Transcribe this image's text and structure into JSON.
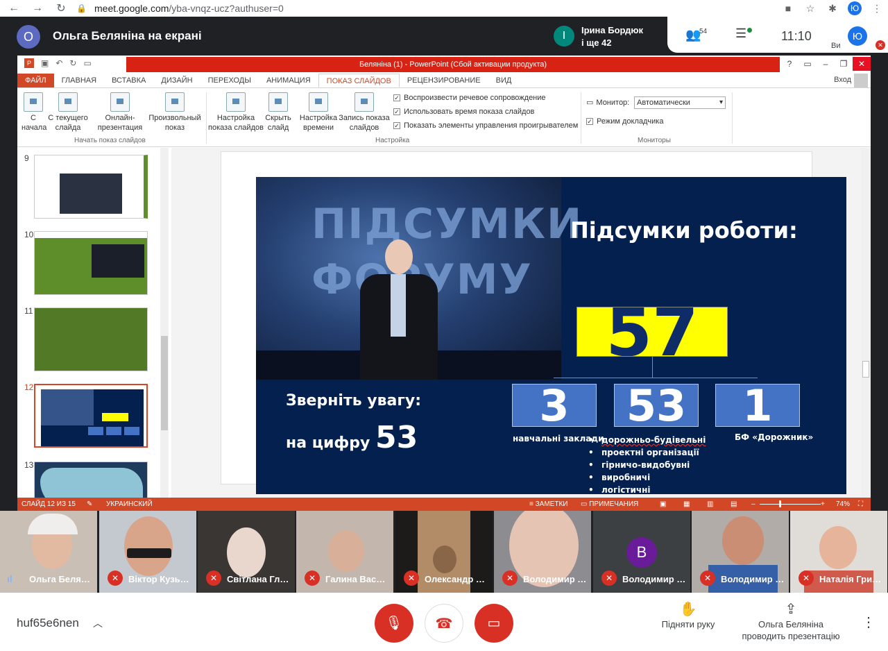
{
  "browser": {
    "url_host": "meet.google.com",
    "url_path": "/yba-vnqz-ucz?authuser=0",
    "avatar_letter": "Ю"
  },
  "meet": {
    "presenter_initial": "О",
    "presenter_title": "Ольга Беляніна на екрані",
    "speaker_initial": "І",
    "speaker_name": "Ірина Бордюк",
    "speaker_more": "і ще 42",
    "people_count": "54",
    "clock": "11:10",
    "self_initial": "Ю",
    "self_label": "Ви"
  },
  "powerpoint": {
    "window_title": "Беляніна (1) -  PowerPoint (Сбой активации продукта)",
    "tabs": [
      "ФАЙЛ",
      "ГЛАВНАЯ",
      "ВСТАВКА",
      "ДИЗАЙН",
      "ПЕРЕХОДЫ",
      "АНИМАЦИЯ",
      "ПОКАЗ СЛАЙДОВ",
      "РЕЦЕНЗИРОВАНИЕ",
      "ВИД"
    ],
    "login": "Вход",
    "ribbon": {
      "from_start": "С начала",
      "from_current": "С текущего слайда",
      "online": "Онлайн-презентация",
      "custom": "Произвольный показ",
      "group_start": "Начать показ слайдов",
      "setup": "Настройка показа слайдов",
      "hide": "Скрыть слайд",
      "timing": "Настройка времени",
      "record": "Запись показа слайдов",
      "group_setup": "Настройка",
      "chk1": "Воспроизвести речевое сопровождение",
      "chk2": "Использовать время показа слайдов",
      "chk3": "Показать элементы управления проигрывателем",
      "monitor_label": "Монитор:",
      "monitor_value": "Автоматически",
      "presenter_mode": "Режим докладчика",
      "group_monitors": "Мониторы"
    },
    "thumb_numbers": [
      "9",
      "10",
      "11",
      "12",
      "13"
    ],
    "status": {
      "slide": "СЛАЙД 12 ИЗ 15",
      "language": "УКРАИНСКИЙ",
      "notes": "ЗАМЕТКИ",
      "comments": "ПРИМЕЧАНИЯ",
      "zoom": "74%"
    }
  },
  "slide": {
    "photo_text": "ПІДСУМКИ ФОРУМУ",
    "title": "Підсумки роботи:",
    "total": "57",
    "box1": "3",
    "box2": "53",
    "box3": "1",
    "cap1": "навчальні заклади",
    "cap3": "БФ «Дорожник»",
    "bullets": [
      "дорожньо-будівельні",
      "проектні організації",
      "гірничо-видобувні",
      "виробничі",
      "логістичні"
    ],
    "attention_line1": "Зверніть увагу:",
    "attention_line2": "на цифру",
    "attention_num": "53"
  },
  "participants": [
    {
      "name": "Ольга Белян…",
      "speaking": true
    },
    {
      "name": "Віктор Кузь…",
      "speaking": false
    },
    {
      "name": "Світлана Гл…",
      "speaking": false
    },
    {
      "name": "Галина Васи…",
      "speaking": false
    },
    {
      "name": "Олександр …",
      "speaking": false
    },
    {
      "name": "Володимир …",
      "speaking": false
    },
    {
      "name": "Володимир …",
      "speaking": false,
      "initial": "В"
    },
    {
      "name": "Володимир …",
      "speaking": false
    },
    {
      "name": "Наталія Гри…",
      "speaking": false
    }
  ],
  "bottom": {
    "meeting_code": "huf65e6nen",
    "raise_hand": "Підняти руку",
    "presenting_line1": "Ольга Беляніна",
    "presenting_line2": "проводить презентацію"
  }
}
